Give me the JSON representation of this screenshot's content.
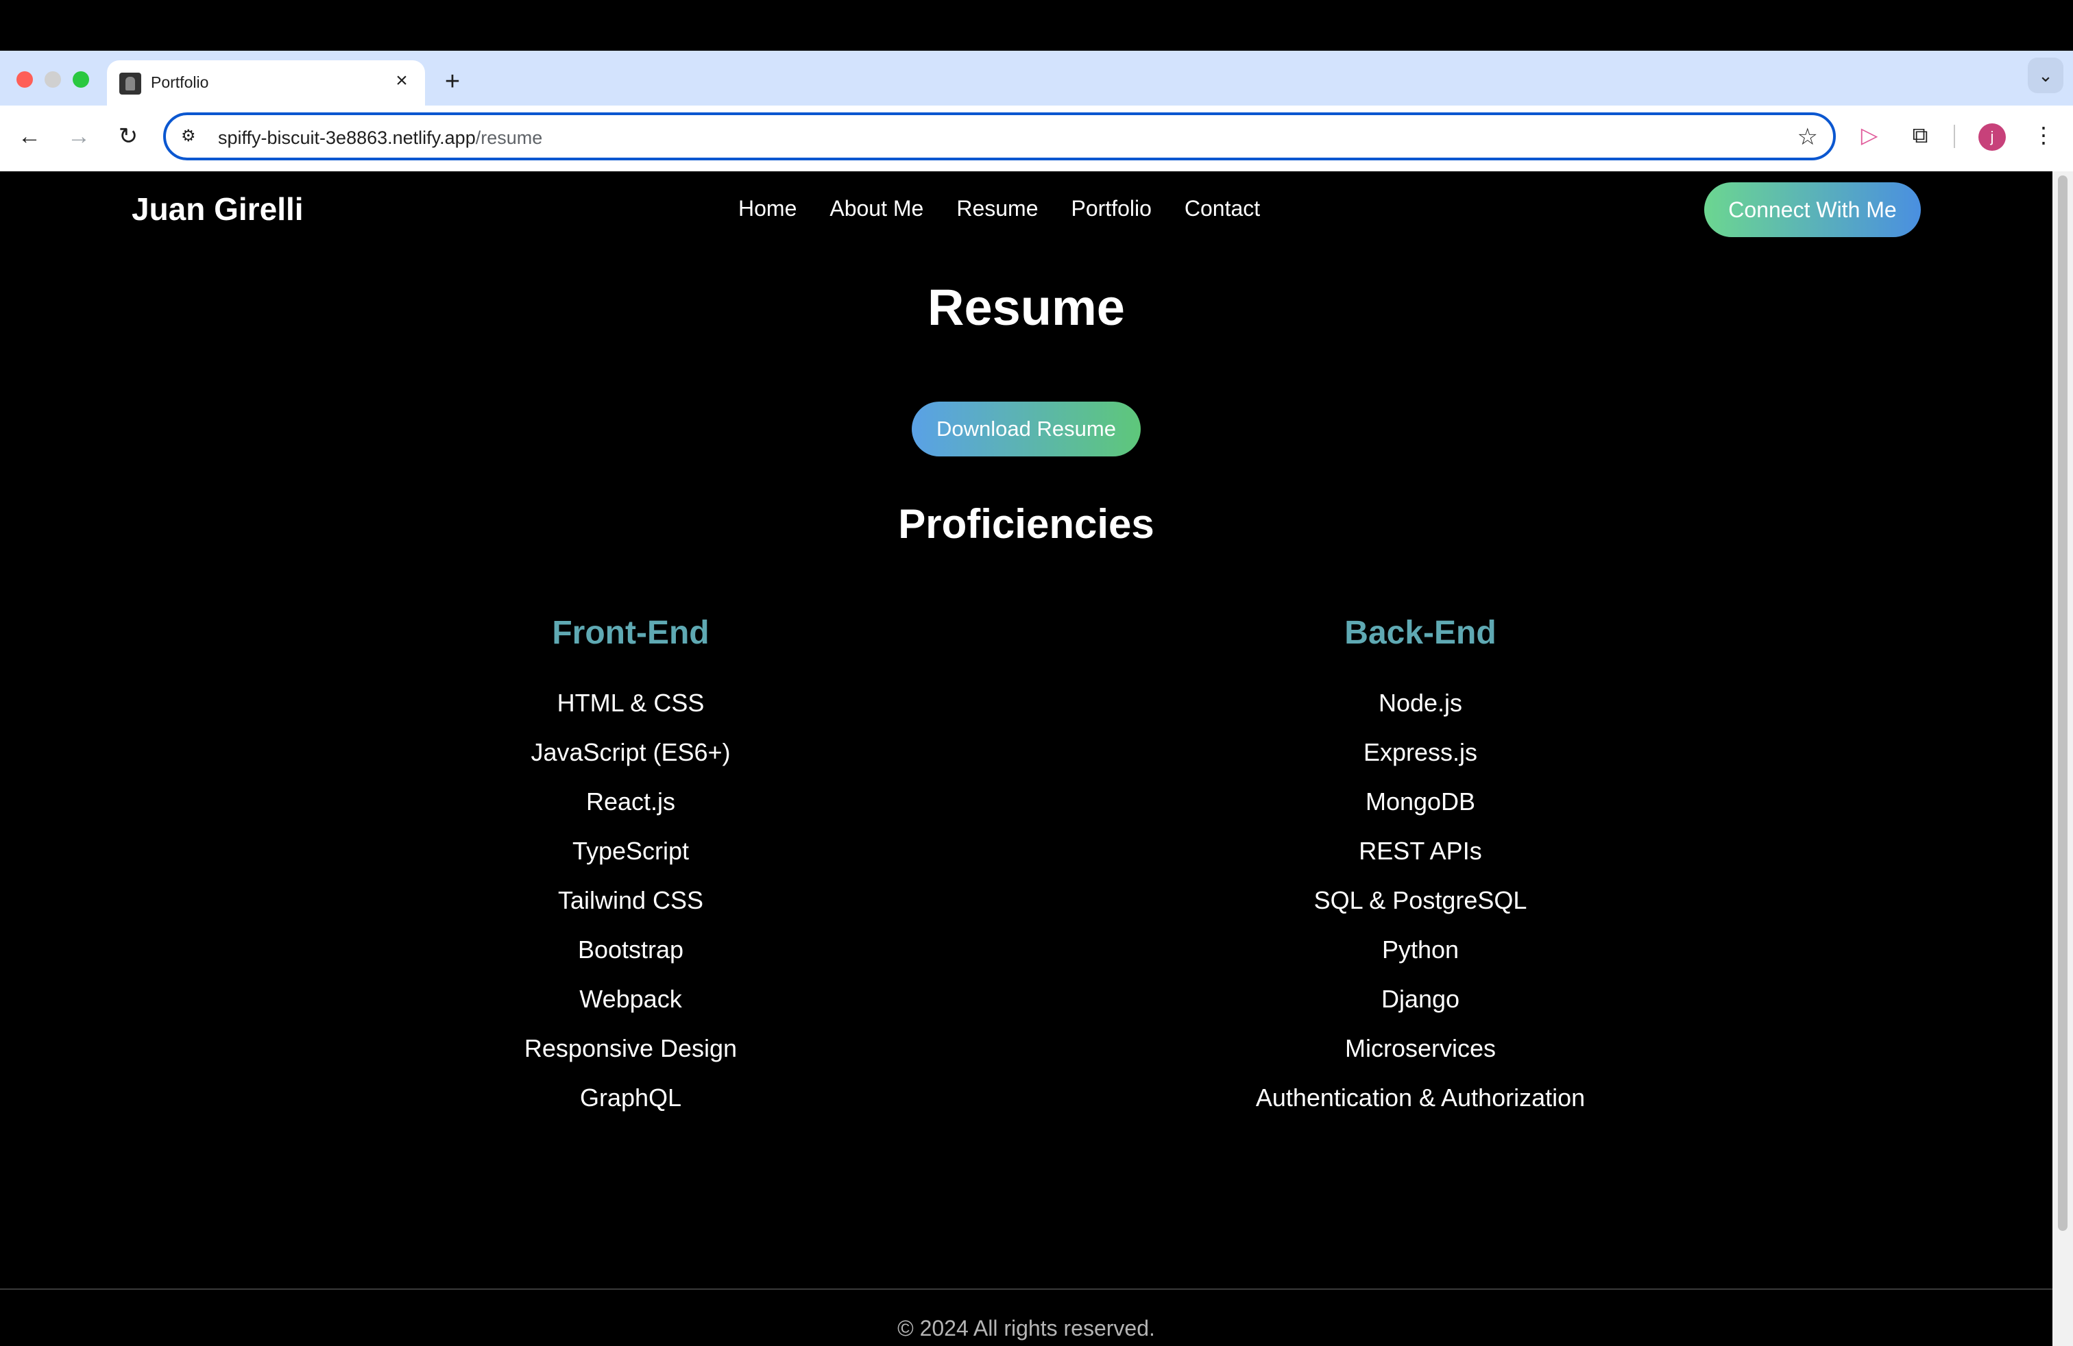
{
  "browser": {
    "tab_title": "Portfolio",
    "tab_close": "×",
    "new_tab": "+",
    "url_host": "spiffy-biscuit-3e8863.netlify.app",
    "url_path": "/resume",
    "avatar_letter": "j"
  },
  "header": {
    "brand": "Juan Girelli",
    "nav": [
      "Home",
      "About Me",
      "Resume",
      "Portfolio",
      "Contact"
    ],
    "connect_label": "Connect With Me"
  },
  "main": {
    "title": "Resume",
    "download_label": "Download Resume",
    "proficiencies_title": "Proficiencies",
    "front_end": {
      "heading": "Front-End",
      "items": [
        "HTML & CSS",
        "JavaScript (ES6+)",
        "React.js",
        "TypeScript",
        "Tailwind CSS",
        "Bootstrap",
        "Webpack",
        "Responsive Design",
        "GraphQL"
      ]
    },
    "back_end": {
      "heading": "Back-End",
      "items": [
        "Node.js",
        "Express.js",
        "MongoDB",
        "REST APIs",
        "SQL & PostgreSQL",
        "Python",
        "Django",
        "Microservices",
        "Authentication & Authorization"
      ]
    }
  },
  "footer": {
    "text": "© 2024 All rights reserved."
  },
  "colors": {
    "accent_heading": "#5fa9b3",
    "background": "#000000"
  }
}
